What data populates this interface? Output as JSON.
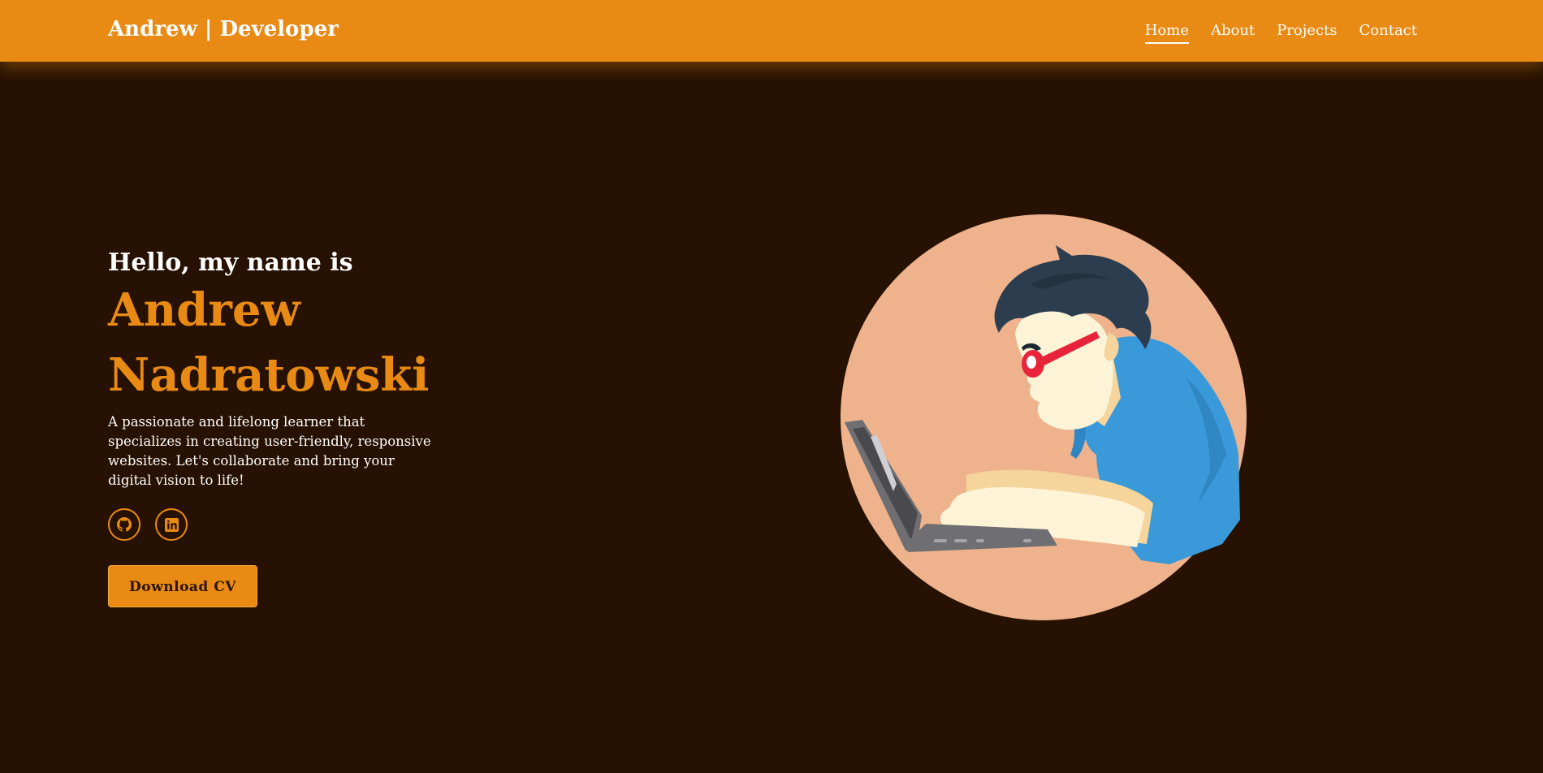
{
  "header": {
    "brand": "Andrew | Developer",
    "nav": [
      {
        "label": "Home",
        "active": true
      },
      {
        "label": "About",
        "active": false
      },
      {
        "label": "Projects",
        "active": false
      },
      {
        "label": "Contact",
        "active": false
      }
    ]
  },
  "hero": {
    "greeting": "Hello, my name is",
    "first_name": "Andrew",
    "last_name": "Nadratowski",
    "tagline": "A passionate and lifelong learner that specializes in creating user-friendly, responsive websites. Let's collaborate and bring your digital vision to life!",
    "socials": [
      {
        "icon": "github-icon"
      },
      {
        "icon": "linkedin-icon"
      }
    ],
    "cta_label": "Download CV",
    "illustration": "developer-at-laptop"
  },
  "colors": {
    "accent": "#e88a13",
    "background": "#261102",
    "text": "#ffffff",
    "circle": "#eeb38c",
    "shirt": "#3a9ad9",
    "hair": "#2b3d4f",
    "glasses": "#e8243b"
  }
}
